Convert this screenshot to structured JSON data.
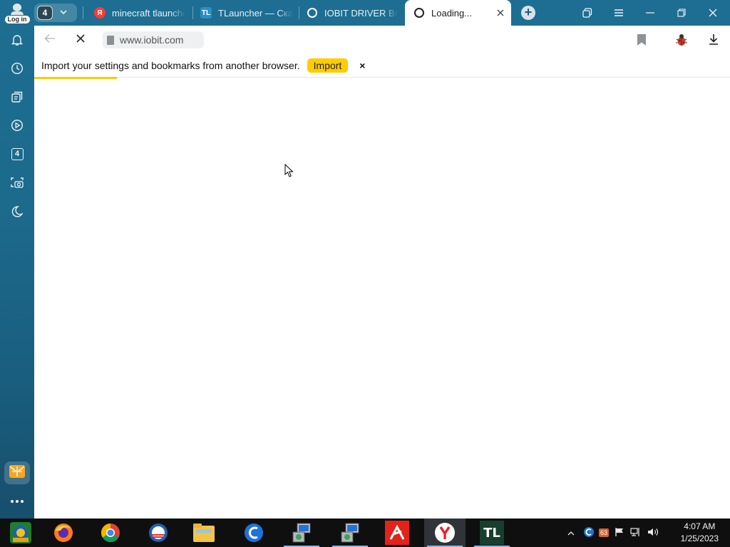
{
  "browser": {
    "profile": {
      "login_label": "Log in"
    },
    "tab_count": "4",
    "tabs": [
      {
        "title": "minecraft tlauncher",
        "favicon": "yandex-icon",
        "favicon_color": "#ff3333",
        "active": false
      },
      {
        "title": "TLauncher — Ска",
        "favicon": "tl-icon",
        "favicon_color": "#2a8fc7",
        "active": false
      },
      {
        "title": "IOBIT DRIVER BOO",
        "favicon": "loading-ring-icon",
        "active": false
      },
      {
        "title": "Loading...",
        "favicon": "loading-ring-icon",
        "active": true
      }
    ],
    "window_controls": [
      "tabs-menu-icon",
      "menu-icon",
      "minimize-icon",
      "restore-icon",
      "close-icon"
    ]
  },
  "sidebar": {
    "items": [
      {
        "name": "bell-icon"
      },
      {
        "name": "history-icon"
      },
      {
        "name": "collections-icon"
      },
      {
        "name": "play-icon"
      },
      {
        "name": "tab-count-icon",
        "label": "4"
      },
      {
        "name": "screenshot-icon"
      },
      {
        "name": "night-mode-icon"
      }
    ],
    "bottom": [
      "mail-icon",
      "add-icon",
      "more-icon"
    ]
  },
  "toolbar": {
    "url": "www.iobit.com",
    "back_icon": "back-arrow-icon",
    "stop_icon": "stop-icon"
  },
  "infobar": {
    "message": "Import your settings and bookmarks from another browser.",
    "button_label": "Import",
    "close_label": "×"
  },
  "page": {
    "loading": true
  },
  "taskbar": {
    "apps": [
      "start-icon",
      "firefox-icon",
      "chrome-icon",
      "outlook-icon",
      "file-explorer-icon",
      "ccleaner-icon",
      "installer-icon",
      "installer-icon-2",
      "avira-icon",
      "yandex-browser-icon",
      "tlauncher-icon"
    ],
    "tray": {
      "clock_time": "4:07 AM",
      "clock_date": "1/25/2023",
      "badge": "63"
    }
  },
  "colors": {
    "accent": "#ffcc00",
    "frame": "#1c6a8c",
    "taskbar": "#0f0f10"
  }
}
